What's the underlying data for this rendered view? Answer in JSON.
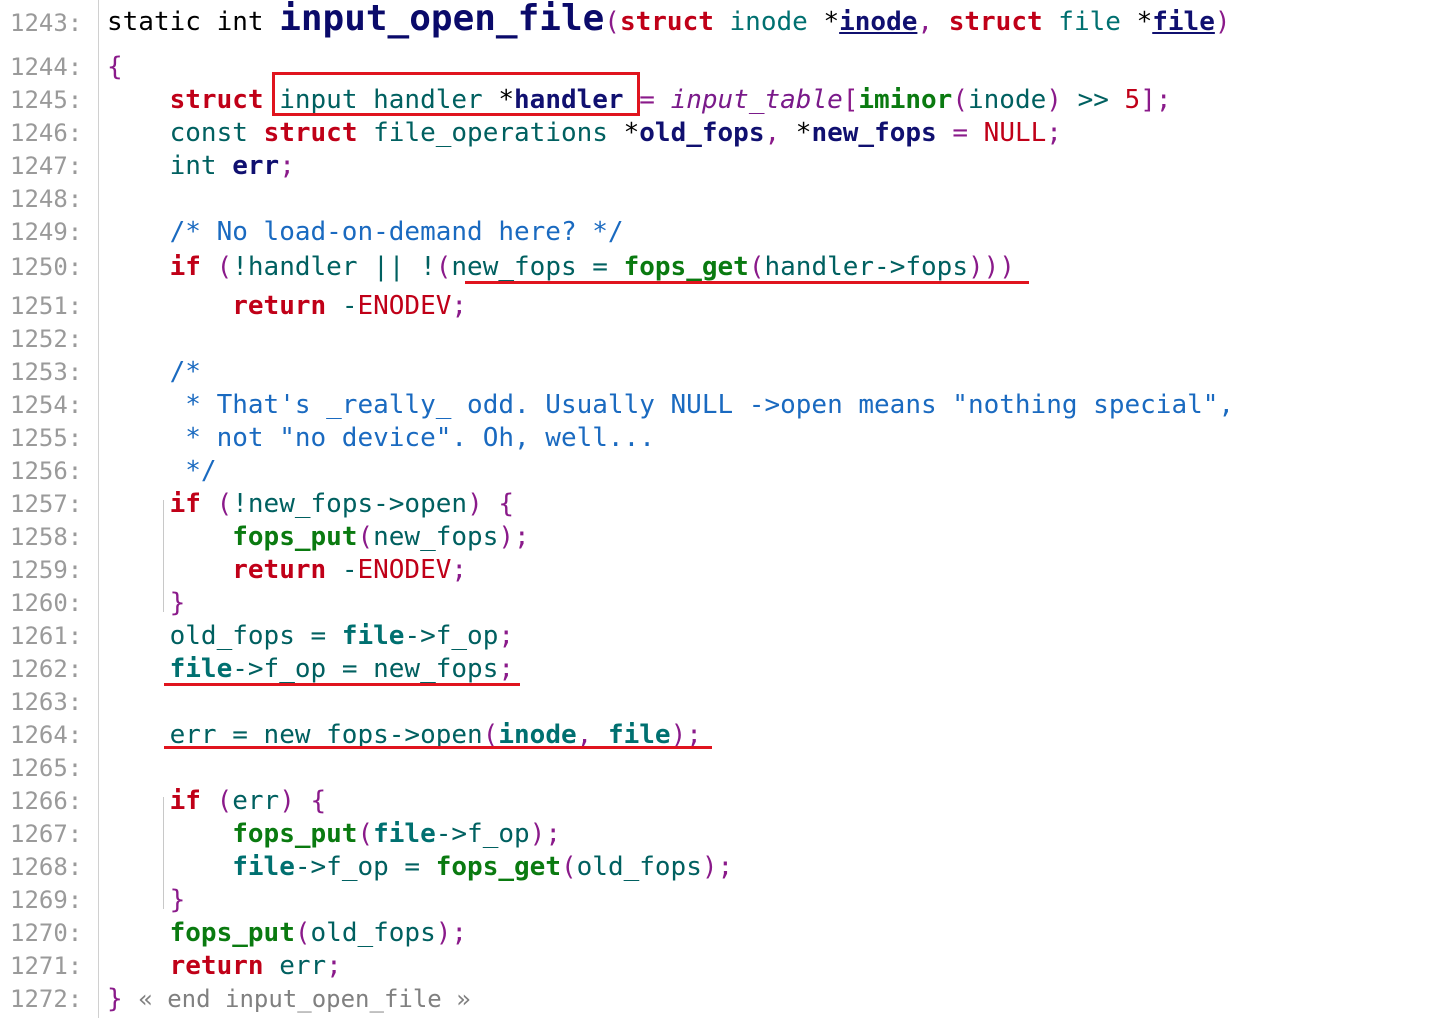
{
  "lines": [
    {
      "n": "1243:",
      "tokens": [
        [
          "t",
          "static int "
        ],
        [
          "title",
          "input_open_file"
        ],
        [
          "pr",
          "("
        ],
        [
          "kw",
          "struct"
        ],
        [
          "t",
          " "
        ],
        [
          "ty",
          "inode"
        ],
        [
          "t",
          " *"
        ],
        [
          "vr uline",
          "inode"
        ],
        [
          "pr",
          ", "
        ],
        [
          "kw",
          "struct"
        ],
        [
          "t",
          " "
        ],
        [
          "ty",
          "file"
        ],
        [
          "t",
          " *"
        ],
        [
          "vr uline",
          "file"
        ],
        [
          "pr",
          ")"
        ]
      ]
    },
    {
      "n": "1244:",
      "tokens": [
        [
          "pr",
          "{"
        ]
      ]
    },
    {
      "n": "1245:",
      "tokens": [
        [
          "t",
          "    "
        ],
        [
          "kw",
          "struct"
        ],
        [
          "t",
          " "
        ],
        [
          "pl",
          "input_handler"
        ],
        [
          "t",
          " *"
        ],
        [
          "vr",
          "handler"
        ],
        [
          "t",
          " "
        ],
        [
          "pr",
          "="
        ],
        [
          "t",
          " "
        ],
        [
          "gv",
          "input_table"
        ],
        [
          "pr",
          "["
        ],
        [
          "fn",
          "iminor"
        ],
        [
          "pr",
          "("
        ],
        [
          "pl",
          "inode"
        ],
        [
          "pr",
          ")"
        ],
        [
          "t",
          " "
        ],
        [
          "pl",
          ">>"
        ],
        [
          "t",
          " "
        ],
        [
          "ct",
          "5"
        ],
        [
          "pr",
          "];"
        ]
      ]
    },
    {
      "n": "1246:",
      "tokens": [
        [
          "t",
          "    "
        ],
        [
          "pl",
          "const"
        ],
        [
          "t",
          " "
        ],
        [
          "kw",
          "struct"
        ],
        [
          "t",
          " "
        ],
        [
          "pl",
          "file_operations"
        ],
        [
          "t",
          " *"
        ],
        [
          "vr",
          "old_fops"
        ],
        [
          "pr",
          ","
        ],
        [
          "t",
          " *"
        ],
        [
          "vr",
          "new_fops"
        ],
        [
          "t",
          " "
        ],
        [
          "pr",
          "="
        ],
        [
          "t",
          " "
        ],
        [
          "ct",
          "NULL"
        ],
        [
          "pr",
          ";"
        ]
      ]
    },
    {
      "n": "1247:",
      "tokens": [
        [
          "t",
          "    "
        ],
        [
          "pl",
          "int"
        ],
        [
          "t",
          " "
        ],
        [
          "vr",
          "err"
        ],
        [
          "pr",
          ";"
        ]
      ]
    },
    {
      "n": "1248:",
      "tokens": []
    },
    {
      "n": "1249:",
      "tokens": [
        [
          "t",
          "    "
        ],
        [
          "cm",
          "/* No load-on-demand here? */"
        ]
      ]
    },
    {
      "n": "1250:",
      "tokens": [
        [
          "t",
          "    "
        ],
        [
          "kw",
          "if"
        ],
        [
          "t",
          " "
        ],
        [
          "pr",
          "("
        ],
        [
          "pl",
          "!handler || !"
        ],
        [
          "pr",
          "("
        ],
        [
          "pl",
          "new_fops = "
        ],
        [
          "fn",
          "fops_get"
        ],
        [
          "pr",
          "("
        ],
        [
          "pl",
          "handler->fops"
        ],
        [
          "pr",
          "))"
        ],
        [
          "pr",
          ")"
        ]
      ]
    },
    {
      "n": "1251:",
      "tokens": [
        [
          "t",
          "        "
        ],
        [
          "kw",
          "return"
        ],
        [
          "t",
          " "
        ],
        [
          "pl",
          "-"
        ],
        [
          "ct",
          "ENODEV"
        ],
        [
          "pr",
          ";"
        ]
      ]
    },
    {
      "n": "1252:",
      "tokens": []
    },
    {
      "n": "1253:",
      "tokens": [
        [
          "t",
          "    "
        ],
        [
          "cm",
          "/*"
        ]
      ]
    },
    {
      "n": "1254:",
      "tokens": [
        [
          "t",
          "    "
        ],
        [
          "cm",
          " * That's _really_ odd. Usually NULL ->open means \"nothing special\","
        ]
      ]
    },
    {
      "n": "1255:",
      "tokens": [
        [
          "t",
          "    "
        ],
        [
          "cm",
          " * not \"no device\". Oh, well..."
        ]
      ]
    },
    {
      "n": "1256:",
      "tokens": [
        [
          "t",
          "    "
        ],
        [
          "cm",
          " */"
        ]
      ]
    },
    {
      "n": "1257:",
      "tokens": [
        [
          "t",
          "    "
        ],
        [
          "kw",
          "if"
        ],
        [
          "t",
          " "
        ],
        [
          "pr",
          "("
        ],
        [
          "pl",
          "!new_fops->open"
        ],
        [
          "pr",
          ")"
        ],
        [
          "t",
          " "
        ],
        [
          "pr",
          "{"
        ]
      ]
    },
    {
      "n": "1258:",
      "tokens": [
        [
          "t",
          "        "
        ],
        [
          "fn",
          "fops_put"
        ],
        [
          "pr",
          "("
        ],
        [
          "pl",
          "new_fops"
        ],
        [
          "pr",
          ");"
        ]
      ]
    },
    {
      "n": "1259:",
      "tokens": [
        [
          "t",
          "        "
        ],
        [
          "kw",
          "return"
        ],
        [
          "t",
          " "
        ],
        [
          "pl",
          "-"
        ],
        [
          "ct",
          "ENODEV"
        ],
        [
          "pr",
          ";"
        ]
      ]
    },
    {
      "n": "1260:",
      "tokens": [
        [
          "t",
          "    "
        ],
        [
          "pr",
          "}"
        ]
      ]
    },
    {
      "n": "1261:",
      "tokens": [
        [
          "t",
          "    "
        ],
        [
          "pl",
          "old_fops = "
        ],
        [
          "tyb",
          "file"
        ],
        [
          "pl",
          "->f_op"
        ],
        [
          "pr",
          ";"
        ]
      ]
    },
    {
      "n": "1262:",
      "tokens": [
        [
          "t",
          "    "
        ],
        [
          "tyb",
          "file"
        ],
        [
          "pl",
          "->f_op = new_fops"
        ],
        [
          "pr",
          ";"
        ]
      ]
    },
    {
      "n": "1263:",
      "tokens": []
    },
    {
      "n": "1264:",
      "tokens": [
        [
          "t",
          "    "
        ],
        [
          "pl",
          "err = new_fops->open"
        ],
        [
          "pr",
          "("
        ],
        [
          "tyb",
          "inode"
        ],
        [
          "pr",
          ","
        ],
        [
          "t",
          " "
        ],
        [
          "tyb",
          "file"
        ],
        [
          "pr",
          ");"
        ]
      ]
    },
    {
      "n": "1265:",
      "tokens": []
    },
    {
      "n": "1266:",
      "tokens": [
        [
          "t",
          "    "
        ],
        [
          "kw",
          "if"
        ],
        [
          "t",
          " "
        ],
        [
          "pr",
          "("
        ],
        [
          "pl",
          "err"
        ],
        [
          "pr",
          ")"
        ],
        [
          "t",
          " "
        ],
        [
          "pr",
          "{"
        ]
      ]
    },
    {
      "n": "1267:",
      "tokens": [
        [
          "t",
          "        "
        ],
        [
          "fn",
          "fops_put"
        ],
        [
          "pr",
          "("
        ],
        [
          "tyb",
          "file"
        ],
        [
          "pl",
          "->f_op"
        ],
        [
          "pr",
          ");"
        ]
      ]
    },
    {
      "n": "1268:",
      "tokens": [
        [
          "t",
          "        "
        ],
        [
          "tyb",
          "file"
        ],
        [
          "pl",
          "->f_op = "
        ],
        [
          "fn",
          "fops_get"
        ],
        [
          "pr",
          "("
        ],
        [
          "pl",
          "old_fops"
        ],
        [
          "pr",
          ");"
        ]
      ]
    },
    {
      "n": "1269:",
      "tokens": [
        [
          "t",
          "    "
        ],
        [
          "pr",
          "}"
        ]
      ]
    },
    {
      "n": "1270:",
      "tokens": [
        [
          "t",
          "    "
        ],
        [
          "fn",
          "fops_put"
        ],
        [
          "pr",
          "("
        ],
        [
          "pl",
          "old_fops"
        ],
        [
          "pr",
          ");"
        ]
      ]
    },
    {
      "n": "1271:",
      "tokens": [
        [
          "t",
          "    "
        ],
        [
          "kw",
          "return"
        ],
        [
          "t",
          " "
        ],
        [
          "pl",
          "err"
        ],
        [
          "pr",
          ";"
        ]
      ]
    },
    {
      "n": "1272:",
      "tokens": [
        [
          "pr",
          "}"
        ],
        [
          "t",
          " "
        ],
        [
          "endc",
          "« end input_open_file »"
        ]
      ]
    }
  ]
}
